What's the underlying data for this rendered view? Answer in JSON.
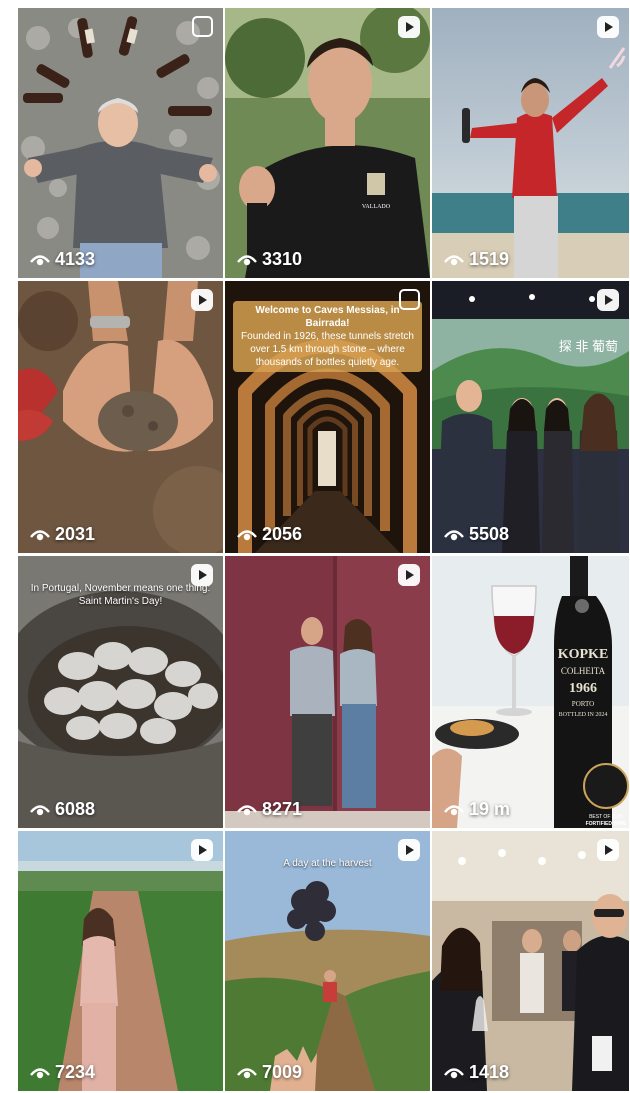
{
  "posts": [
    {
      "views": "4133",
      "badge": "carousel"
    },
    {
      "views": "3310",
      "badge": "reel",
      "shirt_text": "VALLADO"
    },
    {
      "views": "1519",
      "badge": "reel"
    },
    {
      "views": "2031",
      "badge": "reel"
    },
    {
      "views": "2056",
      "badge": "carousel",
      "caption_title": "Welcome to Caves Messias, in Bairrada!",
      "caption_body": "Founded in 1926, these tunnels stretch over 1.5 km through stone – where thousands of bottles quietly age."
    },
    {
      "views": "5508",
      "badge": "reel",
      "banner_text": "探 非 葡萄"
    },
    {
      "views": "6088",
      "badge": "reel",
      "caption_body": "In Portugal, November means one thing: Saint Martin's Day!"
    },
    {
      "views": "8271",
      "badge": "reel"
    },
    {
      "views": "19 m",
      "badge": "none",
      "bottle_brand": "KOPKE",
      "bottle_line": "COLHEITA",
      "bottle_year": "1966",
      "bottle_sub": "PORTO",
      "bottle_sub2": "BOTTLED IN 2024",
      "award_text": "BEST OF 2025",
      "award_text2": "FORTIFIED WINE"
    },
    {
      "views": "7234",
      "badge": "reel"
    },
    {
      "views": "7009",
      "badge": "reel",
      "caption_body": "A day at the harvest"
    },
    {
      "views": "1418",
      "badge": "reel"
    }
  ],
  "colors": {
    "overlay_text": "#ffffff",
    "caption_box": "#d6a050"
  }
}
